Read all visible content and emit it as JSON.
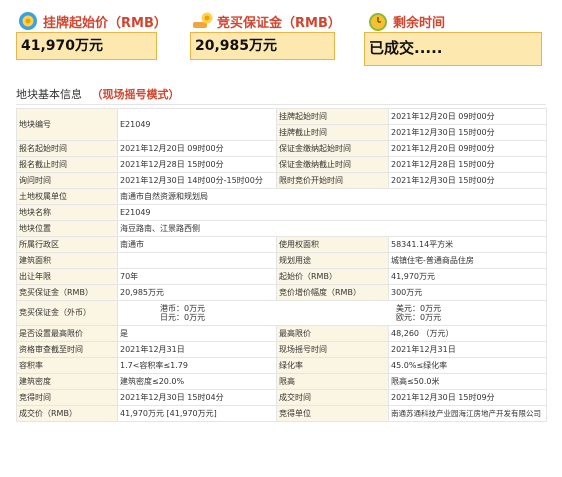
{
  "stats": {
    "start_price": {
      "label": "挂牌起始价（RMB）",
      "value": "41,970万元",
      "icon": "coins-icon"
    },
    "deposit": {
      "label": "竞买保证金（RMB）",
      "value": "20,985万元",
      "icon": "money-hand-icon"
    },
    "remaining": {
      "label": "剩余时间",
      "value": "已成交.....",
      "icon": "clock-icon"
    }
  },
  "section": {
    "title": "地块基本信息",
    "mode": "（现场摇号模式）"
  },
  "table": {
    "r1": {
      "k1": "地块编号",
      "v1": "E21049",
      "k2a": "挂牌起始时间",
      "v2a": "2021年12月20日 09时00分",
      "k2b": "挂牌截止时间",
      "v2b": "2021年12月30日 15时00分"
    },
    "r2": {
      "k1": "报名起始时间",
      "v1": "2021年12月20日 09时00分",
      "k2": "保证金缴纳起始时间",
      "v2": "2021年12月20日 09时00分"
    },
    "r3": {
      "k1": "报名截止时间",
      "v1": "2021年12月28日 15时00分",
      "k2": "保证金缴纳截止时间",
      "v2": "2021年12月28日 15时00分"
    },
    "r4": {
      "k1": "询问时间",
      "v1": "2021年12月30日 14时00分-15时00分",
      "k2": "限时竞价开始时间",
      "v2": "2021年12月30日 15时00分"
    },
    "r5": {
      "k1": "土地权属单位",
      "v1": "南通市自然资源和规划局"
    },
    "r6": {
      "k1": "地块名称",
      "v1": "E21049"
    },
    "r7": {
      "k1": "地块位置",
      "v1": "海豆路南、江景路西侧"
    },
    "r8": {
      "k1": "所属行政区",
      "v1": "南通市",
      "k2": "使用权面积",
      "v2": "58341.14平方米"
    },
    "r9": {
      "k1": "建筑面积",
      "v1": "",
      "k2": "规划用途",
      "v2": "城镇住宅-普通商品住房"
    },
    "r10": {
      "k1": "出让年限",
      "v1": "70年",
      "k2": "起始价（RMB）",
      "v2": "41,970万元"
    },
    "r11": {
      "k1": "竞买保证金（RMB）",
      "v1": "20,985万元",
      "k2": "竞价增价幅度（RMB）",
      "v2": "300万元"
    },
    "r12": {
      "k1": "竞买保证金（外币）",
      "v1a": "港币：0万元",
      "v1b": "日元：0万元",
      "v2a": "美元：0万元",
      "v2b": "欧元：0万元"
    },
    "r13": {
      "k1": "是否设置最高限价",
      "v1": "是",
      "k2": "最高限价",
      "v2": "48,260 （万元）"
    },
    "r14": {
      "k1": "资格审查截至时间",
      "v1": "2021年12月31日",
      "k2": "现场摇号时间",
      "v2": "2021年12月31日"
    },
    "r15": {
      "k1": "容积率",
      "v1": "1.7<容积率≤1.79",
      "k2": "绿化率",
      "v2": "45.0%≤绿化率"
    },
    "r16": {
      "k1": "建筑密度",
      "v1": "建筑密度≤20.0%",
      "k2": "限高",
      "v2": "限高≤50.0米"
    },
    "r17": {
      "k1": "竞得时间",
      "v1": "2021年12月30日 15时04分",
      "k2": "成交时间",
      "v2": "2021年12月30日 15时09分"
    },
    "r18": {
      "k1": "成交价（RMB）",
      "v1": "41,970万元 [41,970万元]",
      "k2": "竞得单位",
      "v2": "南通苏通科技产业园海江房地产开发有限公司"
    }
  }
}
